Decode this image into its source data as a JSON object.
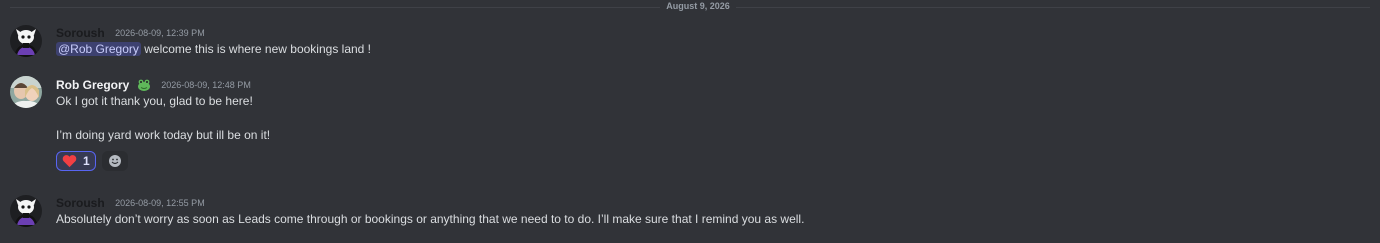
{
  "date_divider": "August 9, 2026",
  "messages": [
    {
      "author": "Soroush",
      "timestamp": "2026-08-09, 12:39 PM",
      "mention": "@Rob Gregory",
      "text": " welcome this is where new bookings land !"
    },
    {
      "author": "Rob Gregory",
      "timestamp": "2026-08-09, 12:48 PM",
      "line1": "Ok I got it thank you, glad to be here!",
      "line2": "I’m doing yard work today but ill be on it!",
      "reaction": {
        "emoji": "heart-emoji",
        "count": "1",
        "color": "#f23f43"
      }
    },
    {
      "author": "Soroush",
      "timestamp": "2026-08-09, 12:55 PM",
      "text": "Absolutely don’t worry as soon as Leads come through or bookings or anything that we need to to do. I’ll make sure that I remind you as well."
    }
  ],
  "colors": {
    "background": "#313338",
    "mention_bg": "#3c4270",
    "accent": "#5865f2"
  }
}
